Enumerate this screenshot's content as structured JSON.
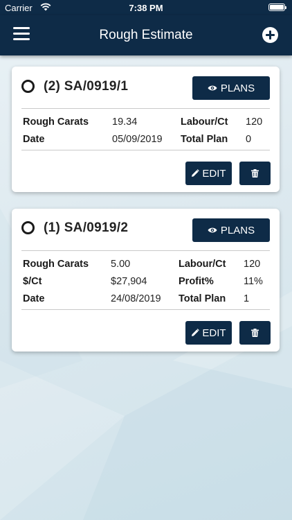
{
  "status_bar": {
    "carrier": "Carrier",
    "time": "7:38 PM"
  },
  "header": {
    "title": "Rough Estimate",
    "menu_icon": "hamburger-menu-icon",
    "add_icon": "add-circle-icon"
  },
  "cards": [
    {
      "code": "(2) SA/0919/1",
      "plans_label": "PLANS",
      "rows": [
        {
          "l1": "Rough Carats",
          "v1": "19.34",
          "l2": "Labour/Ct",
          "v2": "120"
        },
        {
          "l1": "Date",
          "v1": "05/09/2019",
          "l2": "Total Plan",
          "v2": "0"
        }
      ],
      "edit_label": "EDIT"
    },
    {
      "code": "(1) SA/0919/2",
      "plans_label": "PLANS",
      "rows": [
        {
          "l1": "Rough Carats",
          "v1": "5.00",
          "l2": "Labour/Ct",
          "v2": "120"
        },
        {
          "l1": "$/Ct",
          "v1": "$27,904",
          "l2": "Profit%",
          "v2": "11%"
        },
        {
          "l1": "Date",
          "v1": "24/08/2019",
          "l2": "Total Plan",
          "v2": "1"
        }
      ],
      "edit_label": "EDIT"
    }
  ],
  "colors": {
    "primary": "#0e2b47",
    "background": "#dde9ef",
    "card": "#ffffff"
  }
}
